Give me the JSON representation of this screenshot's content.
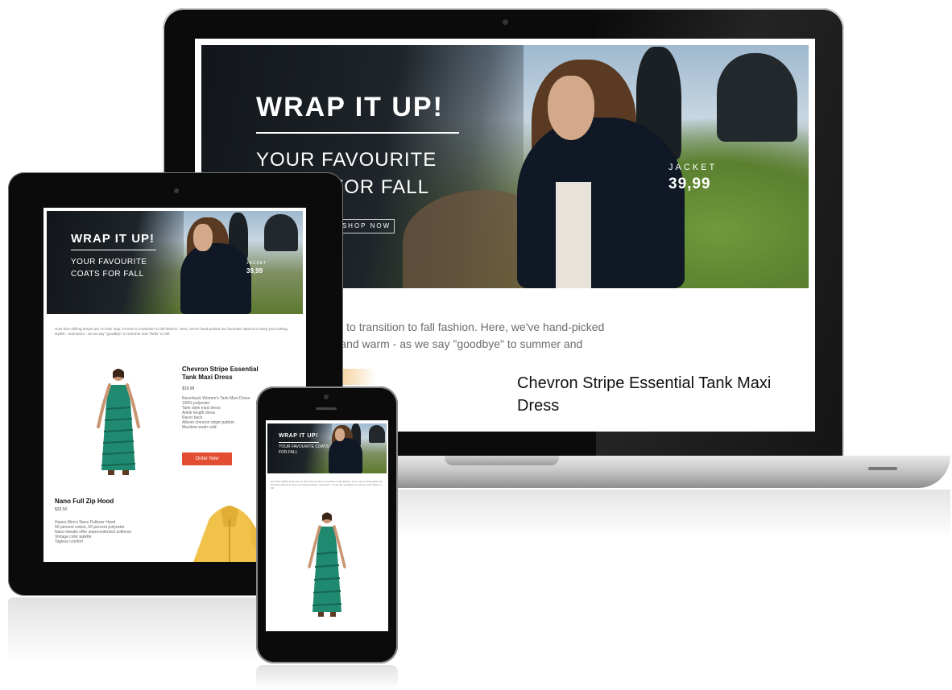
{
  "hero": {
    "title": "WRAP IT UP!",
    "subtitle": "YOUR FAVOURITE COATS FOR FALL",
    "cta_label": "SHOP NOW",
    "price_label": "JACKET",
    "price": "39,99"
  },
  "intro": {
    "laptop_line_1": "s are on their way, it's time to transition to fall fashion. Here, we've hand-picked",
    "laptop_line_2": "keep you looking stylish - and warm - as we say \"goodbye\" to summer and",
    "full": "Now that chilling temps are on their way, it's time to transition to fall fashion. Here, we've hand-picked our favourite options to keep you looking stylish - and warm - as we say \"goodbye\" to summer and \"hello\" to fall."
  },
  "products": [
    {
      "title": "Chevron Stripe Essential Tank Maxi Dress",
      "price": "$19.99",
      "details": [
        "Racerback Women's Tank Maxi Dress",
        "100% polyester",
        "Tank style maxi dress",
        "Ankle length dress",
        "Racer back",
        "Allover chevron stripe pattern",
        "Machine wash cold"
      ],
      "order_label": "Order Now"
    },
    {
      "title": "Nano Full Zip Hood",
      "price": "$33.50",
      "details": [
        "Hanes Men's Nano Pullover Hood",
        "50 percent cotton, 50 percent polyester",
        "Nano tweaks offer unprecedented softness",
        "Vintage color palette",
        "Tagless comfort"
      ]
    }
  ],
  "colors": {
    "device_black": "#0b0b0b",
    "order_button": "#e24e30",
    "dress_teal": "#1f8a70"
  }
}
